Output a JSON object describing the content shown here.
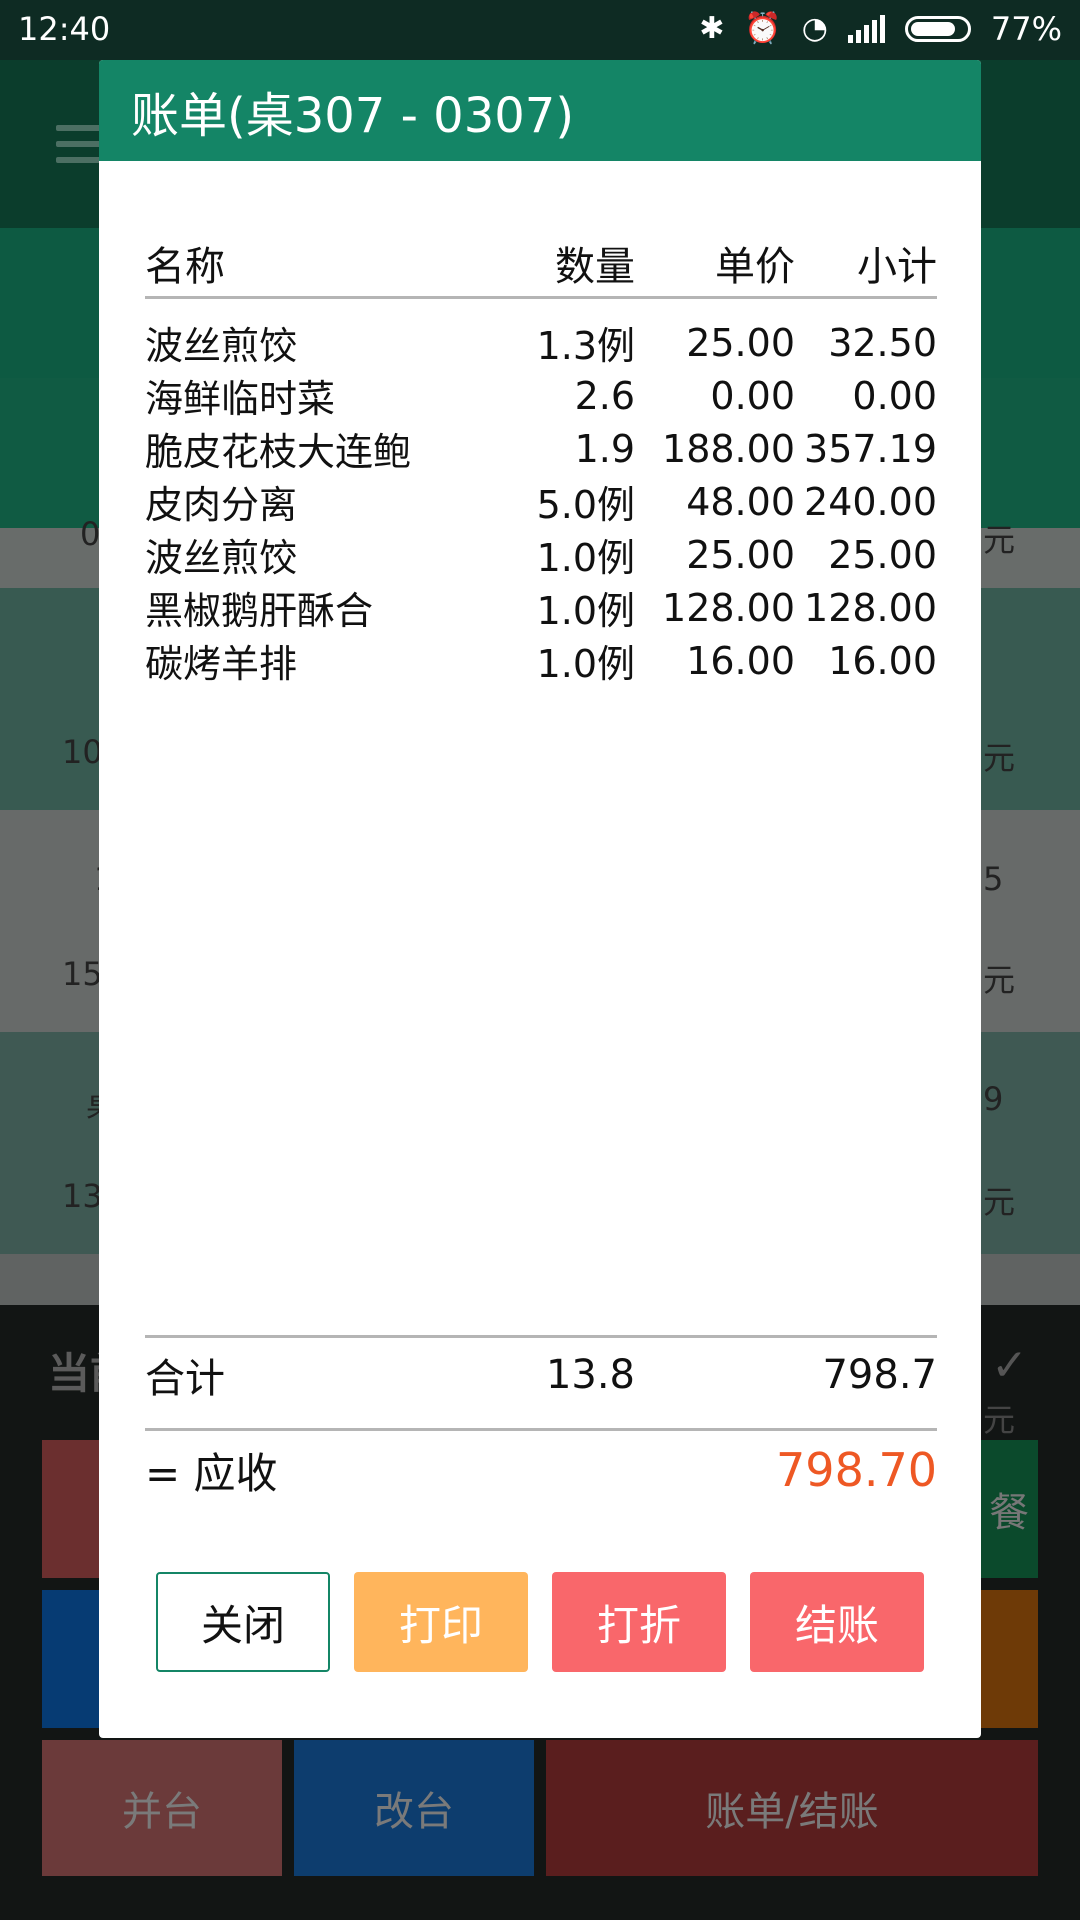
{
  "status_bar": {
    "time": "12:40",
    "battery": "77%"
  },
  "background": {
    "peek_left": [
      "0",
      "10",
      "1",
      "15",
      "桌",
      "13"
    ],
    "peek_right": [
      "元",
      "元",
      "5",
      "元",
      "9",
      "元",
      "元"
    ],
    "bottom_title": "当前",
    "bottom_right_peek": "餐",
    "tiles": {
      "merge": "并台",
      "change": "改台",
      "bill": "账单/结账"
    }
  },
  "dialog": {
    "title": "账单(桌307 - 0307)",
    "columns": {
      "name": "名称",
      "qty": "数量",
      "price": "单价",
      "subtotal": "小计"
    },
    "items": [
      {
        "name": "波丝煎饺",
        "qty": "1.3例",
        "price": "25.00",
        "subtotal": "32.50"
      },
      {
        "name": "海鲜临时菜",
        "qty": "2.6",
        "price": "0.00",
        "subtotal": "0.00"
      },
      {
        "name": "脆皮花枝大连鲍",
        "qty": "1.9",
        "price": "188.00",
        "subtotal": "357.19"
      },
      {
        "name": "皮肉分离",
        "qty": "5.0例",
        "price": "48.00",
        "subtotal": "240.00"
      },
      {
        "name": "波丝煎饺",
        "qty": "1.0例",
        "price": "25.00",
        "subtotal": "25.00"
      },
      {
        "name": "黑椒鹅肝酥合",
        "qty": "1.0例",
        "price": "128.00",
        "subtotal": "128.00"
      },
      {
        "name": "碳烤羊排",
        "qty": "1.0例",
        "price": "16.00",
        "subtotal": "16.00"
      }
    ],
    "total": {
      "label": "合计",
      "qty": "13.8",
      "amount": "798.7"
    },
    "due": {
      "label": "= 应收",
      "amount": "798.70"
    },
    "buttons": {
      "close": "关闭",
      "print": "打印",
      "discount": "打折",
      "settle": "结账"
    }
  },
  "colors": {
    "header": "#148566",
    "due": "#ee5824",
    "print": "#ffb55c",
    "discount": "#f9676b",
    "settle": "#f9676b"
  }
}
